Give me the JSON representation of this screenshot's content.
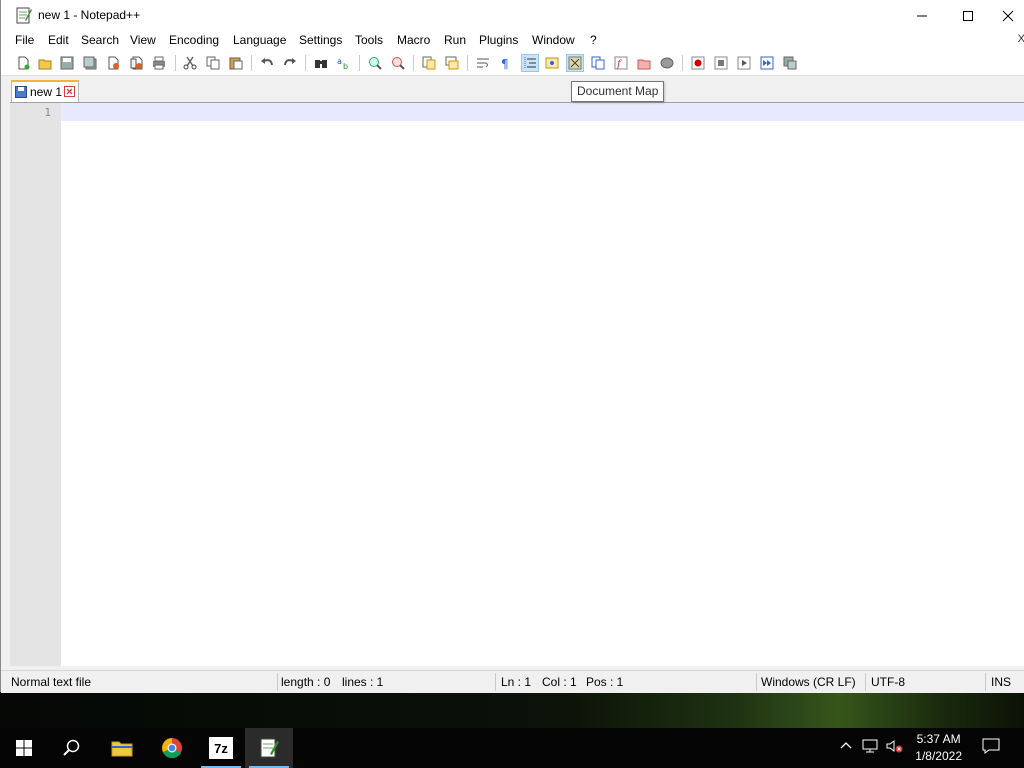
{
  "window": {
    "title": "new 1 - Notepad++"
  },
  "menu": [
    "File",
    "Edit",
    "Search",
    "View",
    "Encoding",
    "Language",
    "Settings",
    "Tools",
    "Macro",
    "Run",
    "Plugins",
    "Window",
    "?"
  ],
  "menubar_close": "X",
  "tab": {
    "label": "new 1"
  },
  "tooltip": "Document Map",
  "editor": {
    "line_number": "1"
  },
  "status": {
    "file_type": "Normal text file",
    "length": "length : 0",
    "lines": "lines : 1",
    "ln": "Ln : 1",
    "col": "Col : 1",
    "pos": "Pos : 1",
    "eol": "Windows (CR LF)",
    "encoding": "UTF-8",
    "mode": "INS"
  },
  "taskbar": {
    "time": "5:37 AM",
    "date": "1/8/2022",
    "sevenzip_label": "7z"
  },
  "colors": {
    "accent": "#fab039",
    "current_line": "#e8e8ff",
    "taskbar": "#050505"
  }
}
